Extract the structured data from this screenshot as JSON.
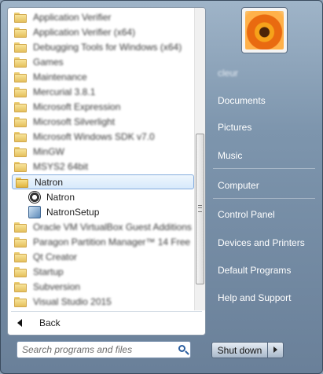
{
  "programs": [
    {
      "label": "Application Verifier",
      "blurred": true
    },
    {
      "label": "Application Verifier (x64)",
      "blurred": true
    },
    {
      "label": "Debugging Tools for Windows (x64)",
      "blurred": true
    },
    {
      "label": "Games",
      "blurred": true
    },
    {
      "label": "Maintenance",
      "blurred": true
    },
    {
      "label": "Mercurial 3.8.1",
      "blurred": true
    },
    {
      "label": "Microsoft Expression",
      "blurred": true
    },
    {
      "label": "Microsoft Silverlight",
      "blurred": true
    },
    {
      "label": "Microsoft Windows SDK v7.0",
      "blurred": true
    },
    {
      "label": "MinGW",
      "blurred": true
    },
    {
      "label": "MSYS2 64bit",
      "blurred": true
    },
    {
      "label": "Natron",
      "blurred": false,
      "selected": true
    },
    {
      "label": "Natron",
      "blurred": false,
      "sub": true,
      "icon": "natron-app-icon"
    },
    {
      "label": "NatronSetup",
      "blurred": false,
      "sub": true,
      "icon": "setup-app-icon"
    },
    {
      "label": "Oracle VM VirtualBox Guest Additions",
      "blurred": true
    },
    {
      "label": "Paragon Partition Manager™ 14 Free",
      "blurred": true
    },
    {
      "label": "Qt Creator",
      "blurred": true
    },
    {
      "label": "Startup",
      "blurred": true
    },
    {
      "label": "Subversion",
      "blurred": true
    },
    {
      "label": "Visual Studio 2015",
      "blurred": true
    }
  ],
  "back_label": "Back",
  "search": {
    "placeholder": "Search programs and files"
  },
  "right": {
    "user_label": "cleur",
    "links": [
      "Documents",
      "Pictures",
      "Music",
      "Computer",
      "Control Panel",
      "Devices and Printers",
      "Default Programs",
      "Help and Support"
    ]
  },
  "shutdown_label": "Shut down"
}
